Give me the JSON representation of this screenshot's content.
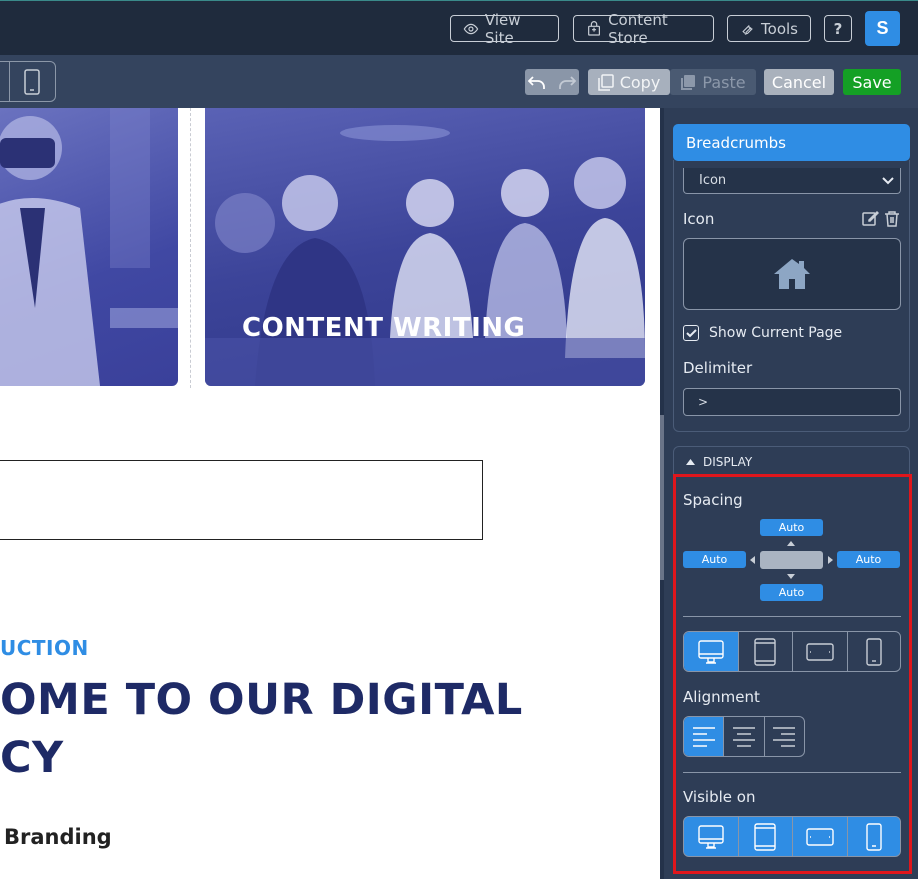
{
  "topbar": {
    "view_site": "View Site",
    "content_store": "Content Store",
    "tools": "Tools",
    "help": "?",
    "avatar_initial": "S"
  },
  "toolbar": {
    "copy": "Copy",
    "paste": "Paste",
    "cancel": "Cancel",
    "save": "Save"
  },
  "canvas": {
    "card_title": "CONTENT WRITING",
    "intro_label": "UCTION",
    "headline_line1": "OME TO OUR DIGITAL",
    "headline_line2": "CY",
    "branding": "Branding"
  },
  "panel": {
    "tab": "Breadcrumbs",
    "icon_select_value": "Icon",
    "icon_label": "Icon",
    "show_current_page": "Show Current Page",
    "show_current_page_checked": true,
    "delimiter_label": "Delimiter",
    "delimiter_value": ">",
    "display_header": "DISPLAY",
    "spacing_label": "Spacing",
    "spacing": {
      "top": "Auto",
      "left": "Auto",
      "right": "Auto",
      "bottom": "Auto"
    },
    "alignment_label": "Alignment",
    "visible_on_label": "Visible on"
  },
  "colors": {
    "accent": "#2f8de4",
    "save_green": "#14a025",
    "highlight_red": "#e0161c",
    "panel_bg": "#2e3d56"
  }
}
